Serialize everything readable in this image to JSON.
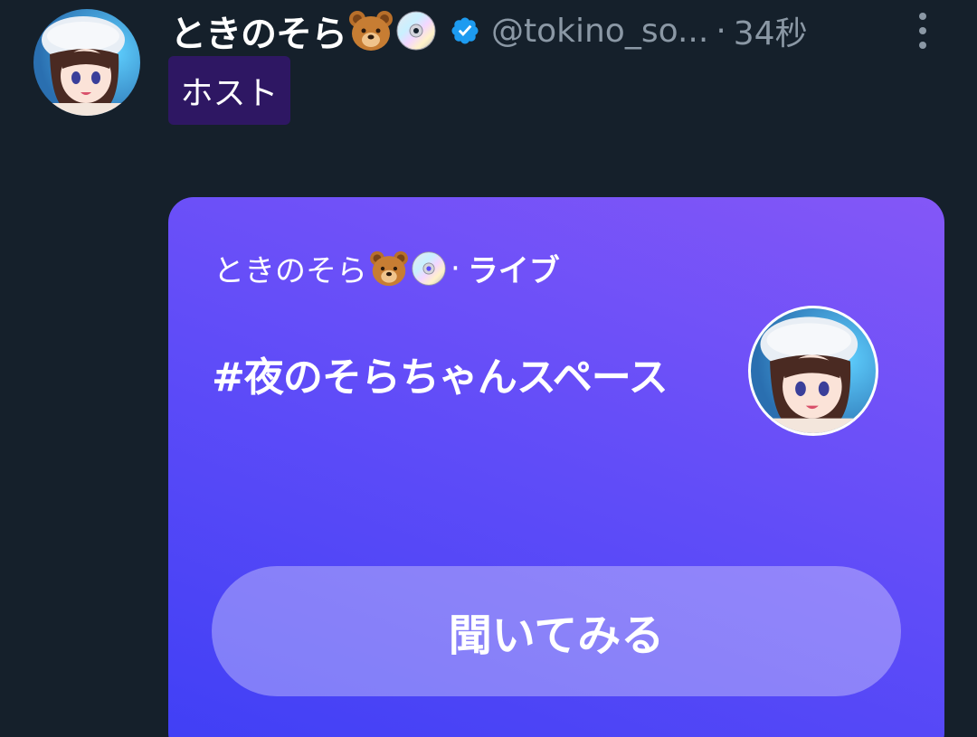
{
  "tweet": {
    "display_name": "ときのそら",
    "handle": "@tokino_so...",
    "separator": "·",
    "timestamp": "34秒",
    "host_label": "ホスト"
  },
  "space_card": {
    "host_name": "ときのそら",
    "separator": "·",
    "status": "ライブ",
    "title": "#夜のそらちゃんスペース",
    "listen_label": "聞いてみる"
  },
  "icons": {
    "name_emojis": [
      "bear-face-icon",
      "dvd-disc-icon"
    ],
    "verified": "verified-badge-icon",
    "more": "more-vertical-icon"
  },
  "colors": {
    "background": "#15202b",
    "secondary_text": "#8b98a5",
    "verified_blue": "#1d9bf0",
    "host_badge": "#2e1763",
    "card_gradient_start": "#3f3ff5",
    "card_gradient_end": "#8457f7"
  }
}
